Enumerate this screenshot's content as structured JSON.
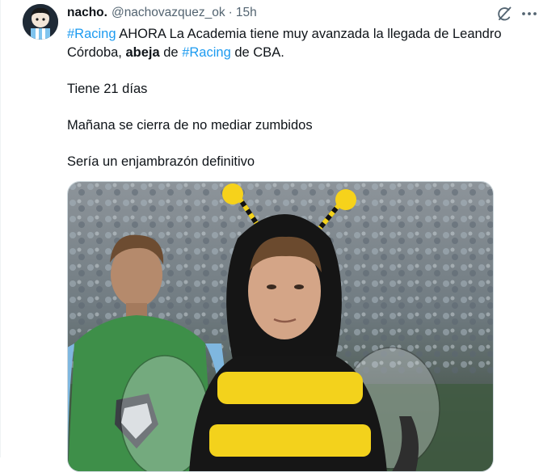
{
  "author": {
    "display_name": "nacho.",
    "handle": "@nachovazquez_ok",
    "separator": "·",
    "timestamp": "15h"
  },
  "icons": {
    "avatar": "avatar-cartoon",
    "grok": "grok-slash-icon",
    "more": "more-dots-icon"
  },
  "tweet": {
    "line1": {
      "hashtag1": "#Racing",
      "text1": " AHORA La Academia tiene muy avanzada la llegada de Leandro Córdoba, ",
      "bold": "abeja",
      "text2": " de ",
      "hashtag2": "#Racing",
      "text3": " de CBA."
    },
    "p2": "Tiene 21 días",
    "p3": "Mañana se cierra de no mediar zumbidos",
    "p4": "Sería un enjambrazón definitivo"
  },
  "colors": {
    "hashtag": "#1d9bf0",
    "secondary_text": "#536471",
    "primary_text": "#0f1419"
  }
}
